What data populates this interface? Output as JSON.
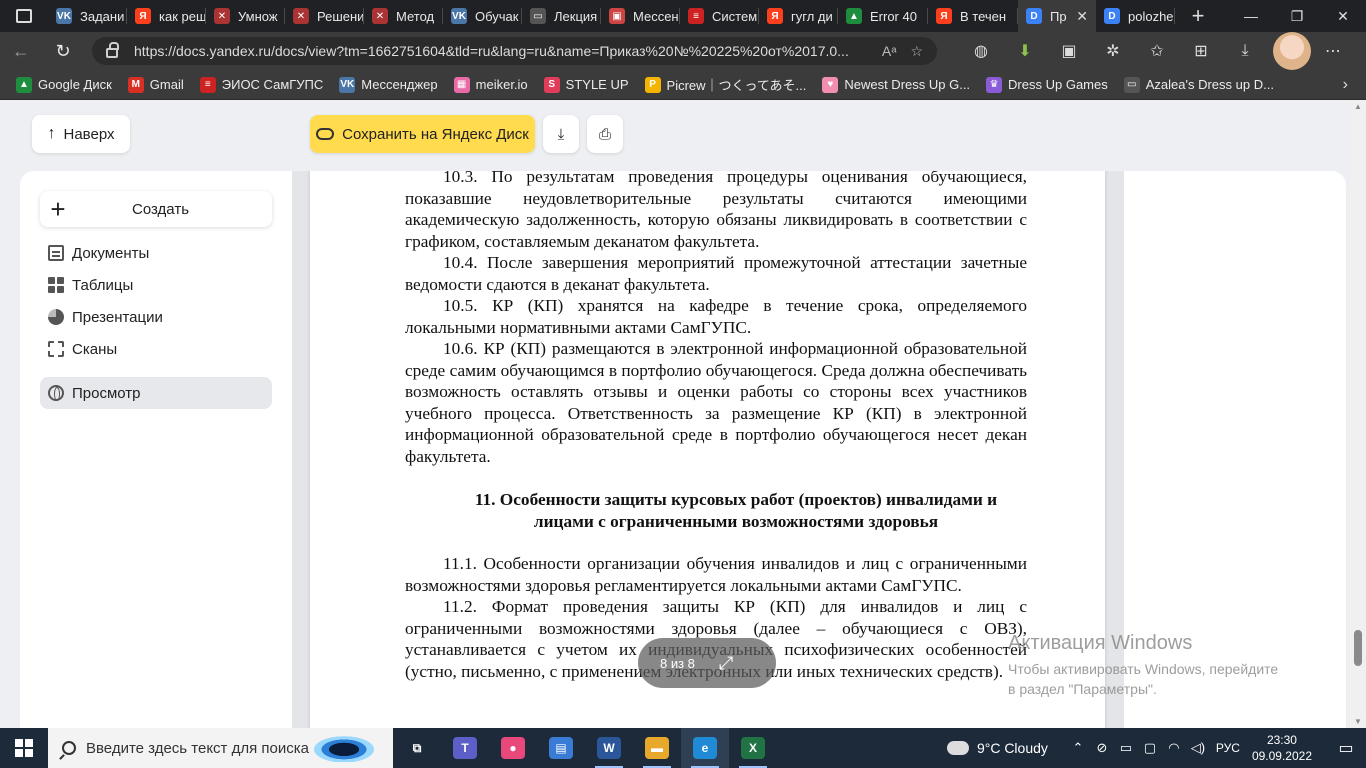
{
  "browser": {
    "tabs": [
      {
        "title": "Задани",
        "icon": "vk-icon",
        "color": "#4a76a8",
        "glyph": "VK"
      },
      {
        "title": "как реш",
        "icon": "yandex-icon",
        "color": "#fc3f1d",
        "glyph": "Я"
      },
      {
        "title": "Умнож",
        "icon": "tools-icon",
        "color": "#a33",
        "glyph": "✕"
      },
      {
        "title": "Решени",
        "icon": "tools-icon",
        "color": "#a33",
        "glyph": "✕"
      },
      {
        "title": "Метод",
        "icon": "tools-icon",
        "color": "#a33",
        "glyph": "✕"
      },
      {
        "title": "Обучак",
        "icon": "vk-icon",
        "color": "#4a76a8",
        "glyph": "VK"
      },
      {
        "title": "Лекция",
        "icon": "document-icon",
        "color": "#555",
        "glyph": "▭"
      },
      {
        "title": "Мессен",
        "icon": "messenger-icon",
        "color": "#c44",
        "glyph": "▣"
      },
      {
        "title": "Систем",
        "icon": "eios-icon",
        "color": "#c22",
        "glyph": "≡"
      },
      {
        "title": "гугл ди",
        "icon": "yandex-icon",
        "color": "#fc3f1d",
        "glyph": "Я"
      },
      {
        "title": "Error 40",
        "icon": "google-drive-icon",
        "color": "#1e8e3e",
        "glyph": "▲"
      },
      {
        "title": "В течен",
        "icon": "yandex-icon",
        "color": "#fc3f1d",
        "glyph": "Я"
      },
      {
        "title": "Пр",
        "icon": "yandex-docs-icon",
        "color": "#3b82f6",
        "glyph": "D",
        "active": true
      },
      {
        "title": "polozhe",
        "icon": "yandex-docs-icon",
        "color": "#3b82f6",
        "glyph": "D"
      }
    ],
    "url": "https://docs.yandex.ru/docs/view?tm=1662751604&tld=ru&lang=ru&name=Приказ%20№%20225%20от%2017.0...",
    "bookmarks": [
      {
        "label": "Google Диск",
        "icon": "google-drive-icon",
        "color": "#1e8e3e",
        "glyph": "▲"
      },
      {
        "label": "Gmail",
        "icon": "gmail-icon",
        "color": "#d93025",
        "glyph": "M"
      },
      {
        "label": "ЭИОС СамГУПС",
        "icon": "eios-icon",
        "color": "#c22",
        "glyph": "≡"
      },
      {
        "label": "Мессенджер",
        "icon": "vk-icon",
        "color": "#4a76a8",
        "glyph": "VK"
      },
      {
        "label": "meiker.io",
        "icon": "meiker-icon",
        "color": "#e86aa6",
        "glyph": "▦"
      },
      {
        "label": "STYLE UP",
        "icon": "styleup-icon",
        "color": "#e23c5b",
        "glyph": "S"
      },
      {
        "label": "Picrew｜つくってあそ...",
        "icon": "picrew-icon",
        "color": "#f5b400",
        "glyph": "P"
      },
      {
        "label": "Newest Dress Up G...",
        "icon": "heart-icon",
        "color": "#f28fb0",
        "glyph": "♥"
      },
      {
        "label": "Dress Up Games",
        "icon": "dressup-icon",
        "color": "#8a5bd6",
        "glyph": "♛"
      },
      {
        "label": "Azalea's Dress up D...",
        "icon": "document-icon",
        "color": "#555",
        "glyph": "▭"
      }
    ]
  },
  "toolbar": {
    "up_label": "Наверх",
    "save_label": "Сохранить на Яндекс Диск"
  },
  "sidebar": {
    "create_label": "Создать",
    "items": [
      {
        "label": "Документы",
        "icon": "documents-icon"
      },
      {
        "label": "Таблицы",
        "icon": "tables-icon"
      },
      {
        "label": "Презентации",
        "icon": "presentations-icon"
      },
      {
        "label": "Сканы",
        "icon": "scans-icon"
      },
      {
        "label": "Просмотр",
        "icon": "view-icon",
        "selected": true
      }
    ]
  },
  "document": {
    "p1": "10.3. По результатам проведения процедуры оценивания обучающиеся, показавшие неудовлетворительные результаты считаются имеющими академическую задолженность, которую обязаны ликвидировать в соответствии с графиком, составляемым деканатом факультета.",
    "p2": "10.4. После завершения мероприятий промежуточной аттестации зачетные ведомости сдаются в деканат факультета.",
    "p3": "10.5. КР (КП) хранятся на кафедре в течение срока, определяемого локальными нормативными актами СамГУПС.",
    "p4": "10.6. КР (КП) размещаются в электронной информационной образовательной среде самим обучающимся в портфолио обучающегося. Среда должна обеспечивать возможность оставлять отзывы и оценки работы со стороны всех участников учебного процесса. Ответственность за размещение КР (КП) в электронной информационной образовательной среде в портфолио обучающегося несет декан факультета.",
    "heading": "11. Особенности защиты курсовых работ (проектов) инвалидами и лицами с ограниченными возможностями здоровья",
    "p5": "11.1. Особенности организации обучения инвалидов и лиц с ограниченными возможностями здоровья регламентируется локальными актами СамГУПС.",
    "p6": "11.2. Формат проведения защиты КР (КП) для инвалидов и лиц с ограниченными возможностями здоровья (далее – обучающиеся с ОВЗ), устанавливается с учетом их индивидуальных психофизических особенностей (устно, письменно, с применением электронных или иных технических средств)."
  },
  "pager": {
    "label": "8 из 8"
  },
  "activation": {
    "title": "Активация Windows",
    "line1": "Чтобы активировать Windows, перейдите",
    "line2": "в раздел \"Параметры\"."
  },
  "taskbar": {
    "search_placeholder": "Введите здесь текст для поиска",
    "apps": [
      {
        "icon": "task-view-icon",
        "glyph": "⧉",
        "color": "transparent"
      },
      {
        "icon": "teams-icon",
        "glyph": "T",
        "color": "#5b5fc7"
      },
      {
        "icon": "paint3d-icon",
        "glyph": "●",
        "color": "#e9487a"
      },
      {
        "icon": "photos-icon",
        "glyph": "▤",
        "color": "#3a7bd5"
      },
      {
        "icon": "word-icon",
        "glyph": "W",
        "color": "#2b579a"
      },
      {
        "icon": "file-explorer-icon",
        "glyph": "▬",
        "color": "#e7a92b"
      },
      {
        "icon": "edge-icon",
        "glyph": "e",
        "color": "#1f8bd6"
      },
      {
        "icon": "excel-icon",
        "glyph": "X",
        "color": "#217346"
      }
    ],
    "weather": "9°C  Cloudy",
    "lang": "РУС",
    "time": "23:30",
    "date": "09.09.2022"
  }
}
